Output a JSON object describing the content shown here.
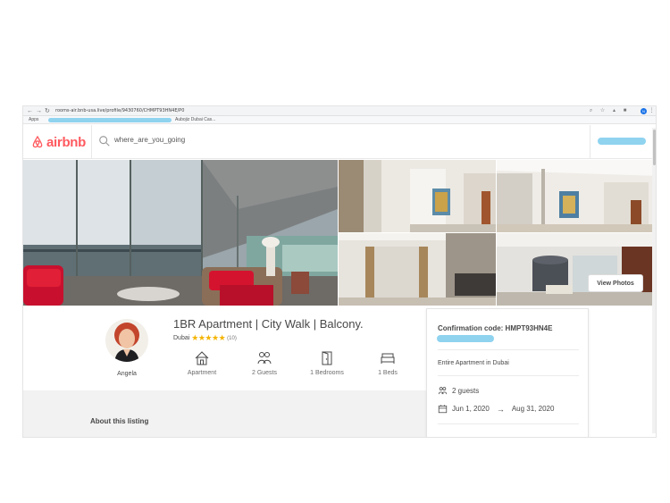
{
  "browser": {
    "url": "rooms-air.bnb-usa.live/profile/9430760/CHMPT93HN4E/P0",
    "apps_label": "Apps",
    "bookmark_2": "Aubojiz Dubai Cas...",
    "profile_initial": "N"
  },
  "header": {
    "brand": "airbnb",
    "search_text": "where_are_you_going",
    "brand_color": "#ff5a5f"
  },
  "photos": {
    "view_label": "View Photos"
  },
  "listing": {
    "title": "1BR Apartment | City Walk | Balcony.",
    "location": "Dubai",
    "rating_stars": "★★★★★",
    "rating_value": 5,
    "reviews": "(10)",
    "host_name": "Angela",
    "amenities": [
      {
        "label": "Apartment",
        "icon": "house-icon"
      },
      {
        "label": "2 Guests",
        "icon": "guests-icon"
      },
      {
        "label": "1 Bedrooms",
        "icon": "door-icon"
      },
      {
        "label": "1 Beds",
        "icon": "bed-icon"
      }
    ]
  },
  "booking": {
    "confirmation": "Confirmation code: HMPT93HN4E",
    "property_type": "Entire Apartment in Dubai",
    "guests": "2 guests",
    "date_start": "Jun 1, 2020",
    "date_arrow": "→",
    "date_end": "Aug 31, 2020"
  },
  "about": {
    "title": "About this listing"
  }
}
